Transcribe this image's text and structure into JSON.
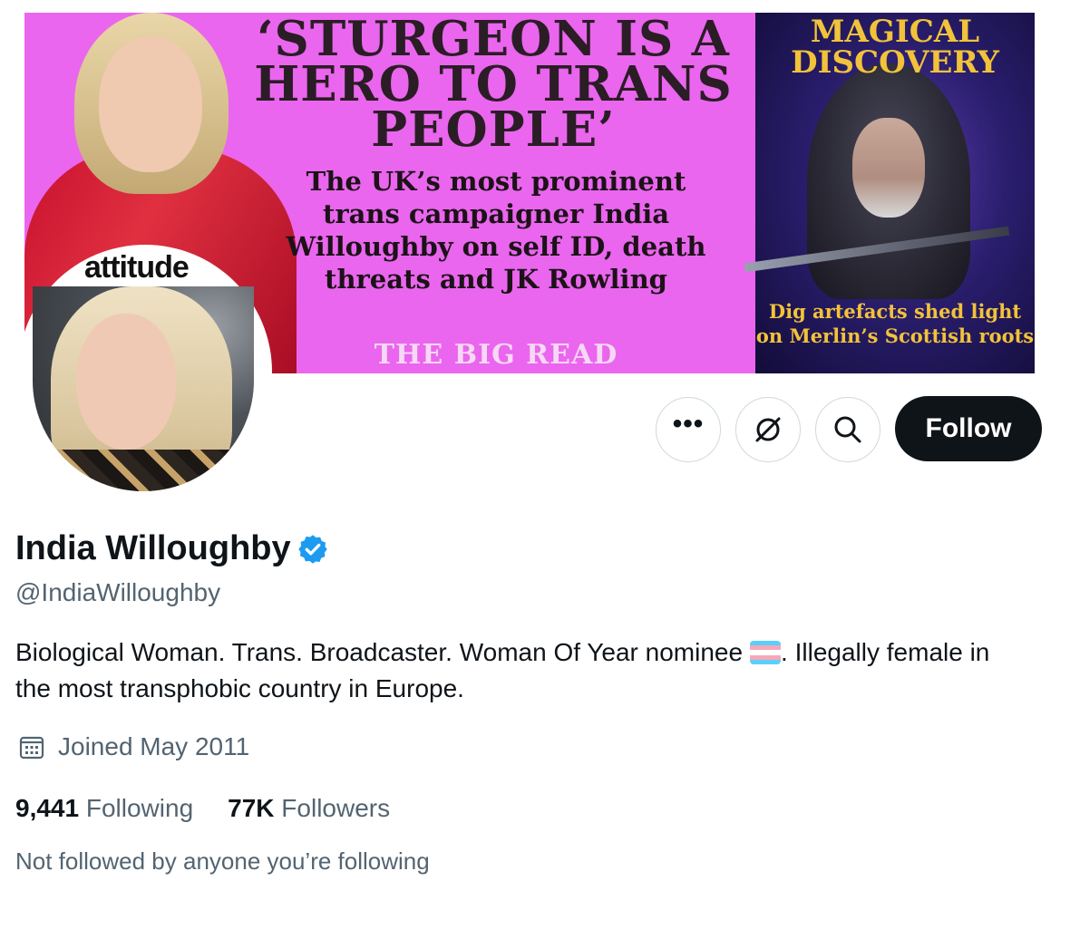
{
  "banner": {
    "headline": "‘STURGEON IS A HERO TO TRANS PEOPLE’",
    "subhead": "The UK’s most prominent trans campaigner India Willoughby on self ID, death threats and JK Rowling",
    "kicker": "THE BIG READ",
    "magazine_logo": "attitude",
    "side_title": "MAGICAL DISCOVERY",
    "side_caption": "Dig artefacts shed light on Merlin’s Scottish roots"
  },
  "actions": {
    "more_icon": "more-dots-icon",
    "grok_icon": "grok-icon",
    "search_icon": "search-icon",
    "follow_label": "Follow"
  },
  "profile": {
    "display_name": "India Willoughby",
    "verified_icon": "verified-badge-icon",
    "handle": "@IndiaWilloughby",
    "bio_part1": "Biological Woman. Trans. Broadcaster. Woman Of Year nominee",
    "bio_flag": "transgender-flag-emoji",
    "bio_part2": ". Illegally female in the most transphobic country in Europe.",
    "joined_icon": "calendar-icon",
    "joined": "Joined May 2011",
    "following_count": "9,441",
    "following_label": "Following",
    "followers_count": "77K",
    "followers_label": "Followers",
    "followed_by": "Not followed by anyone you’re following"
  },
  "colors": {
    "accent": "#1d9bf0",
    "text_primary": "#0f1419",
    "text_secondary": "#536471",
    "banner_pink": "#ea66ee",
    "follow_button": "#0f1419"
  }
}
